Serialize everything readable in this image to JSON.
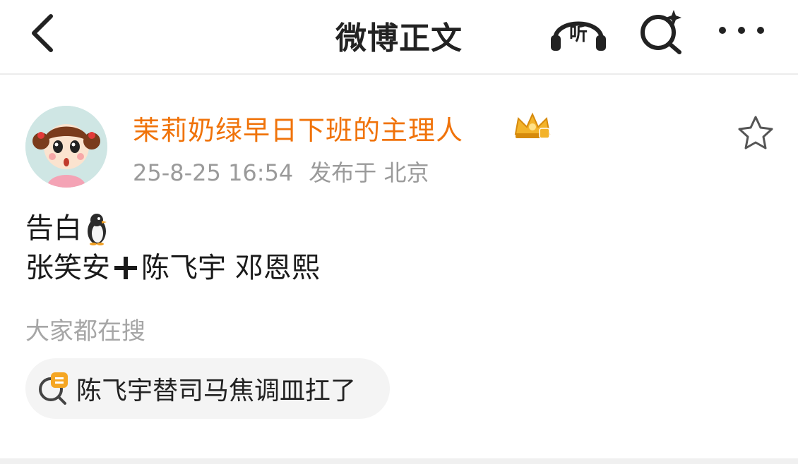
{
  "header": {
    "title": "微博正文",
    "listen_label": "听"
  },
  "post": {
    "author": "茉莉奶绿早日下班的主理人",
    "timestamp": "25-8-25 16:54",
    "location": "发布于 北京",
    "line1": "告白",
    "line2_before": "张笑安",
    "line2_after": "陈飞宇 邓恩熙"
  },
  "hot_search": {
    "title": "大家都在搜",
    "item": "陈飞宇替司马焦调皿扛了"
  },
  "colors": {
    "author": "#f0730a",
    "meta": "#9a9a9a",
    "chip_bg": "#f4f4f4"
  },
  "icons": [
    "back-arrow-icon",
    "headphones-icon",
    "search-sparkle-icon",
    "more-dots-icon",
    "crown-vip-icon",
    "star-outline-icon",
    "penguin-emoji-icon",
    "plus-icon",
    "hot-search-icon"
  ]
}
